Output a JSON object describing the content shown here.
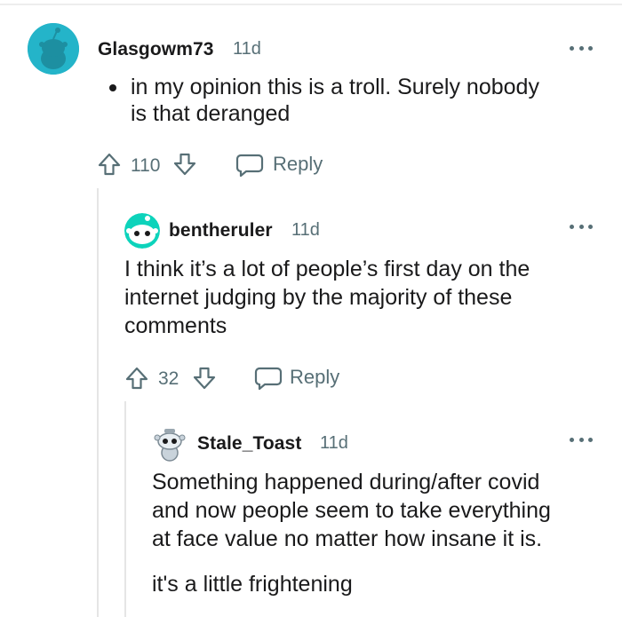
{
  "comments": [
    {
      "username": "Glasgowm73",
      "age": "11d",
      "text_lines": [
        "in my opinion this is a troll. Surely nobody",
        "is that deranged"
      ],
      "score": "110",
      "reply_label": "Reply",
      "avatar_color": "#24b4c9"
    },
    {
      "username": "bentheruler",
      "age": "11d",
      "text_lines": [
        "I think it’s a lot of people’s first day on the",
        "internet judging by the majority of these",
        "comments"
      ],
      "score": "32",
      "reply_label": "Reply",
      "avatar_color": "#0dd3bb"
    },
    {
      "username": "Stale_Toast",
      "age": "11d",
      "text_lines": [
        "Something happened during/after covid",
        "and now people seem to take everything",
        "at face value no matter how insane it is."
      ],
      "text_lines_2": [
        "it's a little frightening"
      ],
      "avatar_color": "#c9d3db"
    }
  ],
  "icons": [
    "more-options-icon",
    "upvote-icon",
    "downvote-icon",
    "reply-icon"
  ],
  "colors": {
    "text": "#1a1a1b",
    "meta": "#576f76",
    "thread_line": "#e5e5e5"
  }
}
